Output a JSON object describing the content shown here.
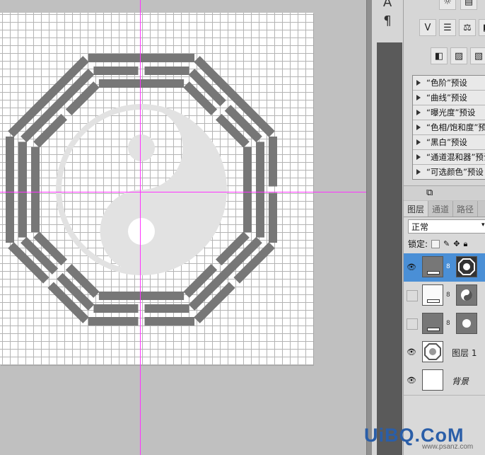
{
  "colors": {
    "workspace": "#c0c0c0",
    "grid_line": "#b4b4b4",
    "guide": "#ff33ff",
    "bagua_bar": "#777777",
    "yinyang": "#e2e2e2",
    "selection": "#4a8fd6"
  },
  "toolbar": {
    "items": [
      {
        "icon": "text-icon",
        "glyph": "A"
      },
      {
        "icon": "paragraph-icon",
        "glyph": "¶"
      }
    ]
  },
  "adjustments": {
    "icons_row1": [
      {
        "icon": "brightness-icon",
        "glyph": "☼"
      },
      {
        "icon": "levels-icon",
        "glyph": "▤"
      }
    ],
    "icons_row2": [
      {
        "icon": "vibrance-icon",
        "glyph": "V"
      },
      {
        "icon": "hsl-icon",
        "glyph": "☰"
      },
      {
        "icon": "color-balance-icon",
        "glyph": "⚖"
      },
      {
        "icon": "black-white-icon",
        "glyph": "◩"
      }
    ],
    "icons_row3": [
      {
        "icon": "photo-filter-icon",
        "glyph": "◧"
      },
      {
        "icon": "channel-mixer-icon",
        "glyph": "▨"
      },
      {
        "icon": "gradient-map-icon",
        "glyph": "▧"
      }
    ],
    "presets": [
      "“色阶”预设",
      "“曲线”预设",
      "“曝光度”预设",
      "“色相/饱和度”预",
      "“黑白”预设",
      "“通道混和器”预设",
      "“可选颜色”预设"
    ]
  },
  "layers": {
    "tabs": [
      "图层",
      "通道",
      "路径"
    ],
    "active_tab": "图层",
    "blend_mode": "正常",
    "lock_label": "锁定:",
    "rows": [
      {
        "name": "",
        "visible": true,
        "selected": true,
        "thumb": "dark",
        "mask": "bagua"
      },
      {
        "name": "",
        "visible": false,
        "selected": false,
        "thumb": "light",
        "mask": "yinyang"
      },
      {
        "name": "",
        "visible": false,
        "selected": false,
        "thumb": "dark",
        "mask": "dot"
      },
      {
        "name": "图层 1",
        "visible": true,
        "selected": false,
        "thumb": "bagua-small",
        "mask": ""
      },
      {
        "name": "背景",
        "visible": true,
        "selected": false,
        "thumb": "white",
        "mask": ""
      }
    ]
  },
  "watermark": {
    "logo": "UiBQ.CoM",
    "url": "www.psanz.com"
  }
}
